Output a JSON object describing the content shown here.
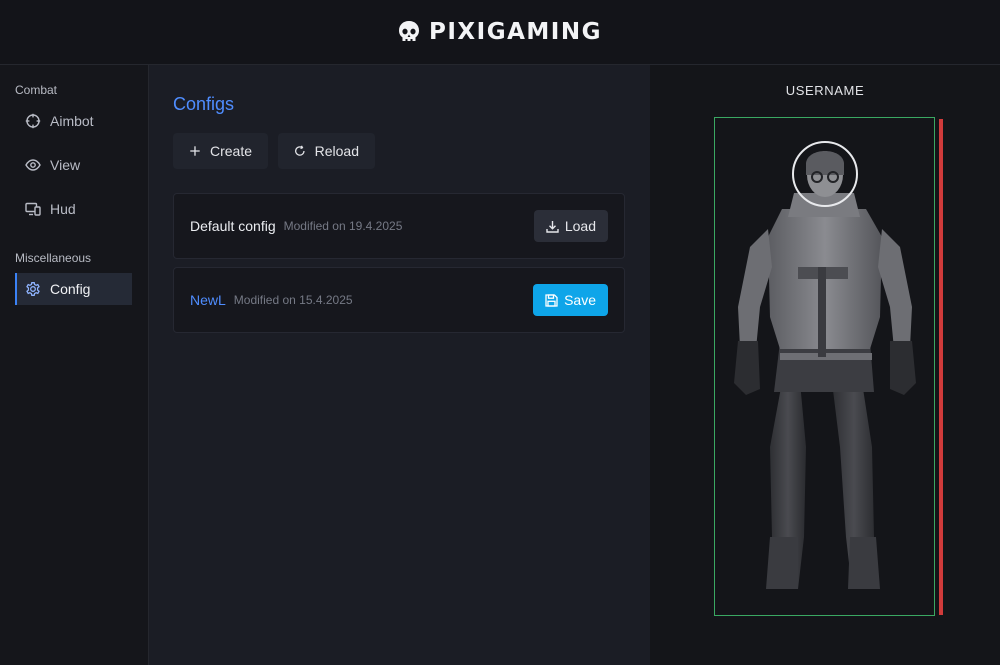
{
  "header": {
    "title": "PIXIGAMING",
    "logo_icon": "skull-icon"
  },
  "sidebar": {
    "sections": [
      {
        "label": "Combat"
      },
      {
        "label": "Miscellaneous"
      }
    ],
    "items": [
      {
        "label": "Aimbot",
        "icon": "crosshair-icon"
      },
      {
        "label": "View",
        "icon": "eye-icon"
      },
      {
        "label": "Hud",
        "icon": "monitor-icon"
      },
      {
        "label": "Config",
        "icon": "gear-icon",
        "active": true
      }
    ]
  },
  "main": {
    "title": "Configs",
    "buttons": {
      "create": "Create",
      "reload": "Reload"
    },
    "configs": [
      {
        "name": "Default config",
        "modified": "Modified on 19.4.2025",
        "action": "Load",
        "action_icon": "download-icon"
      },
      {
        "name": "NewL",
        "modified": "Modified on 15.4.2025",
        "action": "Save",
        "action_icon": "save-icon"
      }
    ]
  },
  "preview": {
    "username": "USERNAME",
    "colors": {
      "box": "#3aa862",
      "health": "#d13b3b",
      "accent": "#4f8dff",
      "save": "#0ea5e9"
    }
  }
}
